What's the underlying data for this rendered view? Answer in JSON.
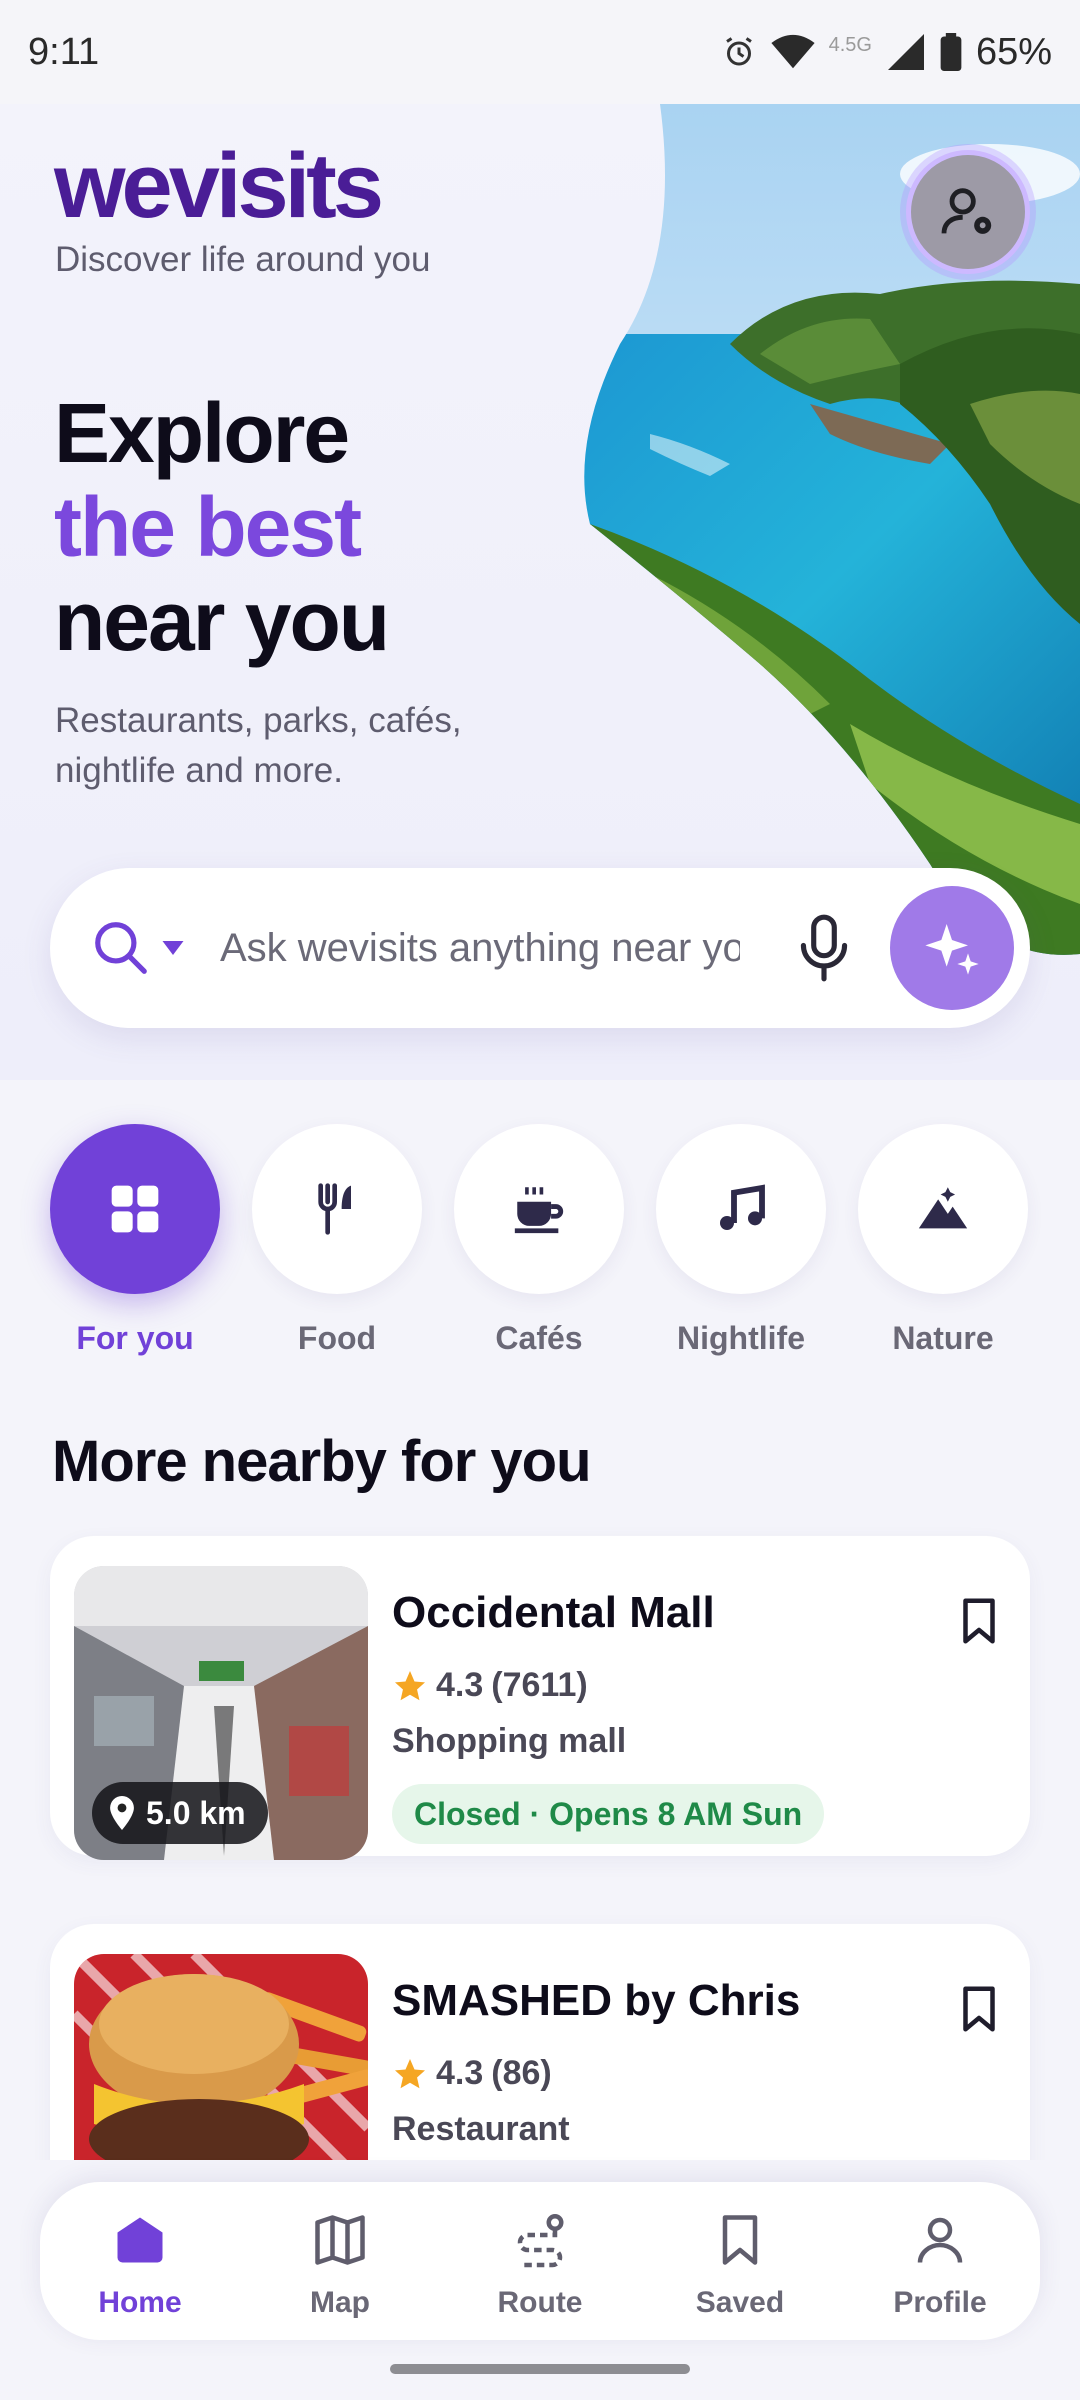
{
  "status_bar": {
    "time": "9:11",
    "network": "4.5G",
    "battery": "65%"
  },
  "header": {
    "brand": "wevisits",
    "tagline": "Discover life around you",
    "headline_line1": "Explore",
    "headline_line2": "the best",
    "headline_line3": "near you",
    "subline": "Restaurants, parks, cafés, nightlife and more."
  },
  "search": {
    "placeholder": "Ask wevisits anything near you"
  },
  "categories": [
    {
      "label": "For you",
      "icon": "grid-icon",
      "active": true
    },
    {
      "label": "Food",
      "icon": "fork-knife-icon",
      "active": false
    },
    {
      "label": "Cafés",
      "icon": "coffee-cup-icon",
      "active": false
    },
    {
      "label": "Nightlife",
      "icon": "music-note-icon",
      "active": false
    },
    {
      "label": "Nature",
      "icon": "mountain-icon",
      "active": false
    }
  ],
  "section": {
    "title": "More nearby for you"
  },
  "places": [
    {
      "name": "Occidental Mall",
      "rating": "4.3",
      "reviews": "(7611)",
      "type": "Shopping mall",
      "status": "Closed · Opens 8 AM Sun",
      "distance": "5.0 km"
    },
    {
      "name": "SMASHED by Chris",
      "rating": "4.3",
      "reviews": "(86)",
      "type": "Restaurant"
    }
  ],
  "bottom_nav": [
    {
      "label": "Home",
      "icon": "home-icon",
      "active": true
    },
    {
      "label": "Map",
      "icon": "map-icon",
      "active": false
    },
    {
      "label": "Route",
      "icon": "route-icon",
      "active": false
    },
    {
      "label": "Saved",
      "icon": "bookmark-icon",
      "active": false
    },
    {
      "label": "Profile",
      "icon": "person-icon",
      "active": false
    }
  ],
  "colors": {
    "accent": "#7141d8",
    "brand": "#4a1d96",
    "status_open_green": "#1f8a48",
    "star": "#f5a623"
  }
}
